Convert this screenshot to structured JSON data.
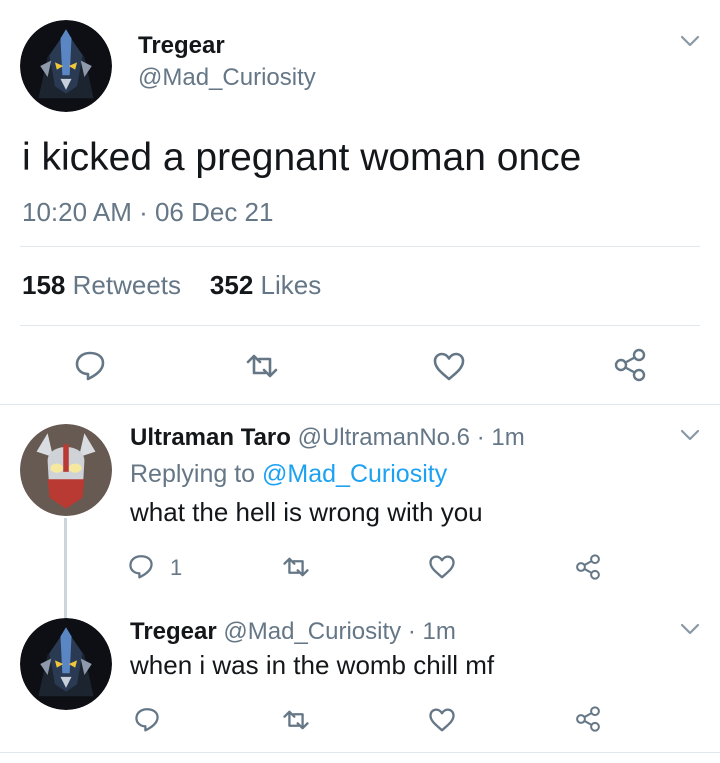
{
  "main_tweet": {
    "name": "Tregear",
    "handle": "@Mad_Curiosity",
    "text": "i kicked a pregnant woman once",
    "timestamp": "10:20 AM · 06 Dec 21",
    "retweets_count": "158",
    "retweets_label": "Retweets",
    "likes_count": "352",
    "likes_label": "Likes"
  },
  "replies": [
    {
      "name": "Ultraman Taro",
      "handle": "@UltramanNo.6",
      "separator": "·",
      "time": "1m",
      "replying_prefix": "Replying to",
      "replying_to": "@Mad_Curiosity",
      "text": "what the hell is wrong with you",
      "reply_count": "1"
    },
    {
      "name": "Tregear",
      "handle": "@Mad_Curiosity",
      "separator": "·",
      "time": "1m",
      "text": "when i was in the womb chill mf"
    }
  ],
  "icons": {
    "reply": "reply-icon",
    "retweet": "retweet-icon",
    "like": "heart-icon",
    "share": "share-icon",
    "menu": "chevron-down-icon"
  },
  "colors": {
    "text": "#14171a",
    "secondary": "#657786",
    "link": "#1da1f2",
    "divider": "#e1e8ed"
  }
}
